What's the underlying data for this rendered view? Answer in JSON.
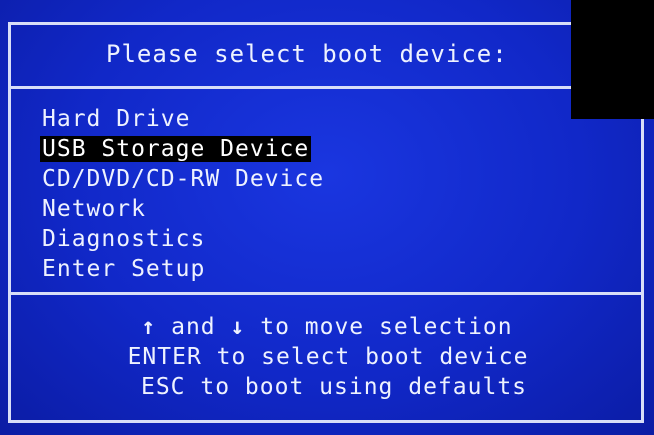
{
  "title": "Please select boot device:",
  "menu": {
    "items": [
      {
        "label": "Hard Drive"
      },
      {
        "label": "USB Storage Device"
      },
      {
        "label": "CD/DVD/CD-RW Device"
      },
      {
        "label": "Network"
      },
      {
        "label": "Diagnostics"
      },
      {
        "label": "Enter Setup"
      }
    ],
    "selected_index": 1
  },
  "help": {
    "move_up_icon": "↑",
    "move_text_and": "and",
    "move_down_icon": "↓",
    "move_text_rest": "to move selection",
    "enter_line": "ENTER to select boot device",
    "esc_line": "ESC to boot using defaults"
  },
  "colors": {
    "background": "#1128c8",
    "text": "#eef2ff",
    "selection_bg": "#000000",
    "border": "#d8def8"
  }
}
